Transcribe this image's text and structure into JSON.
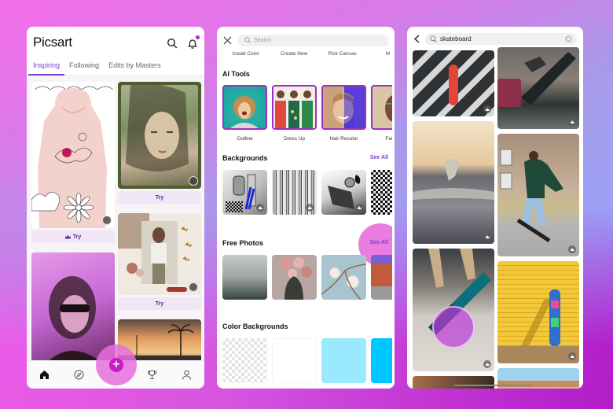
{
  "screens": {
    "home": {
      "logo": "Picsart",
      "tabs": [
        {
          "label": "Inspiring",
          "active": true
        },
        {
          "label": "Following",
          "active": false
        },
        {
          "label": "Edits by Masters",
          "active": false
        }
      ],
      "cards": [
        {
          "column": "left",
          "image": "pink hoodie doodle",
          "button": "Try",
          "premium": true
        },
        {
          "column": "right",
          "image": "green portrait",
          "button": "Try",
          "premium": false
        },
        {
          "column": "right",
          "image": "butterfly collage",
          "button": "Try",
          "premium": false
        },
        {
          "column": "left",
          "image": "pink sunglasses portrait"
        },
        {
          "column": "right",
          "image": "palm trees sunset"
        }
      ],
      "bottom_nav": [
        {
          "icon": "home-icon",
          "active": true
        },
        {
          "icon": "compass-icon"
        },
        {
          "icon": "plus-icon",
          "label": "+"
        },
        {
          "icon": "trophy-icon"
        },
        {
          "icon": "profile-icon"
        }
      ],
      "accent_color": "#c81bc5",
      "tab_color": "#7b3fd1"
    },
    "explore": {
      "search_placeholder": "Search",
      "quick_actions": [
        "Install Color",
        "Create New",
        "Pick Canvas",
        "M"
      ],
      "sections": {
        "ai_tools": {
          "title": "AI Tools",
          "items": [
            "Outline",
            "Dress Up",
            "Hair Recolor",
            "Face A"
          ]
        },
        "backgrounds": {
          "title": "Backgrounds",
          "see_all": "See All"
        },
        "free_photos": {
          "title": "Free Photos",
          "see_all": "See All"
        },
        "color_backgrounds": {
          "title": "Color Backgrounds",
          "colors": [
            "transparent",
            "#ffffff",
            "#9be9fd",
            "#00c6ff"
          ]
        }
      }
    },
    "search": {
      "query": "skateboard",
      "results": [
        {
          "column": "left",
          "image": "red penny board on crosswalk",
          "premium": true
        },
        {
          "column": "right",
          "image": "skateboard kickflip street",
          "premium": true
        },
        {
          "column": "left",
          "image": "skatepark sunset",
          "premium": true
        },
        {
          "column": "right",
          "image": "skater green jacket",
          "premium": true
        },
        {
          "column": "left",
          "image": "teal skateboard jump",
          "premium": true
        },
        {
          "column": "right",
          "image": "skateboard yellow wall",
          "premium": true
        },
        {
          "column": "left",
          "image": "lights"
        },
        {
          "column": "right",
          "image": "beach boardwalk"
        }
      ]
    }
  }
}
